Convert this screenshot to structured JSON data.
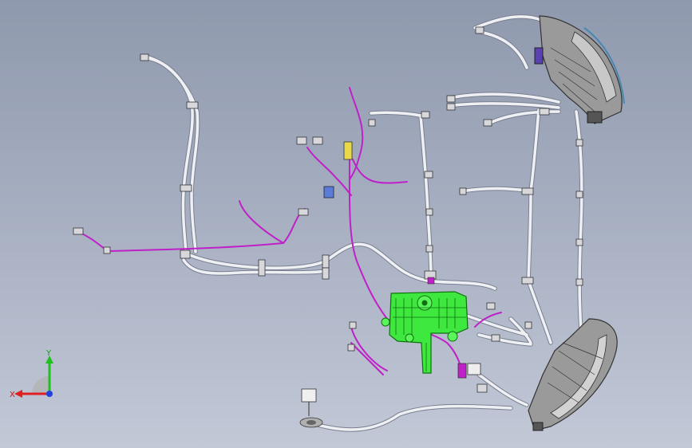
{
  "scene": {
    "background_top": "#8f99ad",
    "background_bottom": "#c2c8d6",
    "wire_color": "#eef0f4",
    "wire_outline": "#6e7482",
    "harness_accent": "#c020c8",
    "bracket_color": "#3ee83e",
    "connector_yellow": "#e8d84a",
    "connector_blue": "#5a7cd8",
    "lamp_housing": "#8a8a8a"
  },
  "triad": {
    "x_label": "X",
    "y_label": "Y",
    "x_color": "#e02020",
    "y_color": "#20c020",
    "z_color": "#2040e0"
  }
}
